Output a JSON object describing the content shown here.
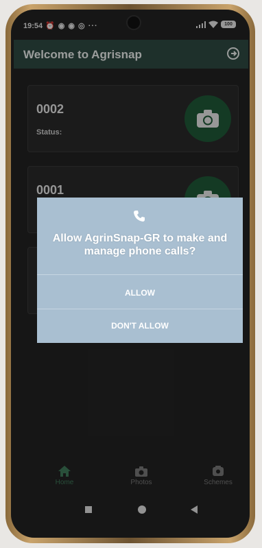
{
  "status_bar": {
    "time": "19:54",
    "notification_icons": "⏰ ◉ ◉ ◎ ···",
    "battery": "100"
  },
  "app_bar": {
    "title": "Welcome to Agrisnap"
  },
  "cards": [
    {
      "id": "0002",
      "status_label": "Status:"
    },
    {
      "id": "0001",
      "status_label": ""
    }
  ],
  "dialog": {
    "message": "Allow AgrinSnap-GR to make and manage phone calls?",
    "allow_label": "ALLOW",
    "deny_label": "DON'T ALLOW"
  },
  "bottom_nav": {
    "items": [
      {
        "label": "Home",
        "active": true,
        "icon": "home-icon"
      },
      {
        "label": "Photos",
        "active": false,
        "icon": "camera-icon"
      },
      {
        "label": "Schemes",
        "active": false,
        "icon": "schemes-icon"
      }
    ]
  },
  "colors": {
    "app_bar": "#2e4a43",
    "camera_button": "#1f5a38",
    "dialog": "#a9bfd1",
    "nav_active": "#2e6a4a"
  }
}
